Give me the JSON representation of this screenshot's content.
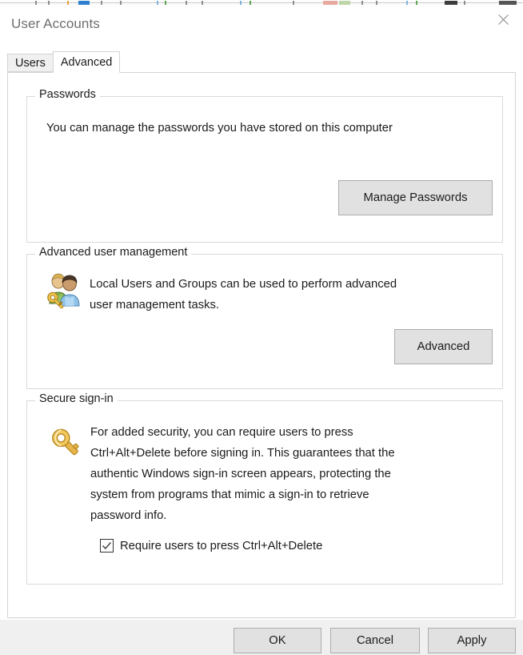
{
  "window": {
    "title": "User Accounts",
    "close_icon": "close-icon"
  },
  "tabs": [
    {
      "label": "Users",
      "active": false
    },
    {
      "label": "Advanced",
      "active": true
    }
  ],
  "groups": {
    "passwords": {
      "legend": "Passwords",
      "description": "You can manage the passwords you have stored on this computer",
      "button": "Manage Passwords"
    },
    "advanced_user_management": {
      "legend": "Advanced user management",
      "icon": "users-with-key-icon",
      "description_line1": "Local Users and Groups can be used to perform advanced",
      "description_line2": "user management tasks.",
      "button": "Advanced"
    },
    "secure_signin": {
      "legend": "Secure sign-in",
      "icon": "key-icon",
      "description_line1": "For added security, you can require users to press",
      "description_line2": "Ctrl+Alt+Delete before signing in. This guarantees that the",
      "description_line3": "authentic Windows sign-in screen appears, protecting the",
      "description_line4": "system from programs that mimic a sign-in to retrieve",
      "description_line5": "password info.",
      "checkbox_label": "Require users to press Ctrl+Alt+Delete",
      "checkbox_checked": "checked"
    }
  },
  "footer": {
    "ok": "OK",
    "cancel": "Cancel",
    "apply": "Apply"
  },
  "colors": {
    "window_bg": "#ffffff",
    "footer_bg": "#f0f0f0",
    "button_face": "#e1e1e1",
    "button_border": "#adadad",
    "group_border": "#d9d9d9",
    "title_text": "#6e6e6e",
    "body_text": "#1b1b1b",
    "key_gold": "#e8b54a",
    "tab_inactive_bg": "#f0f0f0"
  }
}
